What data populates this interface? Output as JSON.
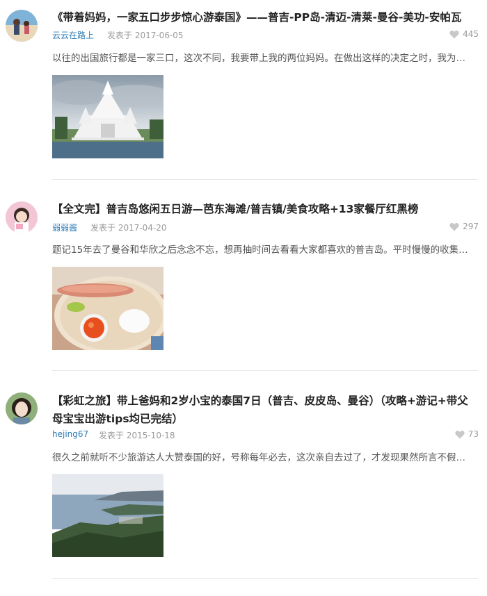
{
  "posts": [
    {
      "title": "《带着妈妈，一家五口步步惊心游泰国》——普吉-PP岛-清迈-清莱-曼谷-美功-安帕瓦",
      "author": "云云在路上",
      "date": "发表于 2017-06-05",
      "likes": "445",
      "excerpt": "以往的出国旅行都是一家三口，这次不同，我要带上我的两位妈妈。在做出这样的决定之时，我为…"
    },
    {
      "title": "【全文完】普吉岛悠闲五日游—芭东海滩/普吉镇/美食攻略+13家餐厅红黑榜",
      "author": "弱弱酱",
      "date": "发表于 2017-04-20",
      "likes": "297",
      "excerpt": "题记15年去了曼谷和华欣之后念念不忘，想再抽时间去看看大家都喜欢的普吉岛。平时慢慢的收集…"
    },
    {
      "title": "【彩虹之旅】带上爸妈和2岁小宝的泰国7日（普吉、皮皮岛、曼谷）（攻略+游记+带父母宝宝出游tips均已完结）",
      "author": "hejing67",
      "date": "发表于 2015-10-18",
      "likes": "73",
      "excerpt": "很久之前就听不少旅游达人大赞泰国的好，号称每年必去，这次亲自去过了，才发现果然所言不假…"
    }
  ]
}
